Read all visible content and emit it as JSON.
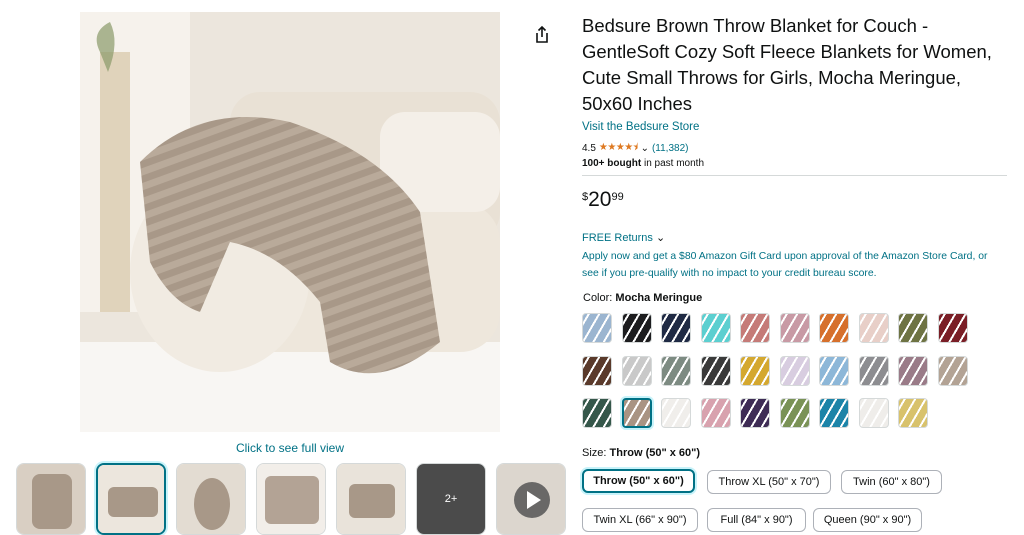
{
  "product": {
    "title": "Bedsure Brown Throw Blanket for Couch - GentleSoft Cozy Soft Fleece Blankets for Women, Cute Small Throws for Girls, Mocha Meringue, 50x60 Inches",
    "store_link": "Visit the Bedsure Store",
    "rating_value": "4.5",
    "rating_stars": "★★★★⯨",
    "rating_count": "(11,382)",
    "bought_bold": "100+ bought",
    "bought_rest": " in past month"
  },
  "price": {
    "symbol": "$",
    "whole": "20",
    "fraction": "99"
  },
  "returns_label": "FREE Returns",
  "promo_text": "Apply now and get a $80 Amazon Gift Card upon approval of the Amazon Store Card, or see if you pre-qualify with no impact to your credit bureau score.",
  "gallery": {
    "full_view_label": "Click to see full view",
    "more_label": "2+",
    "colors": {
      "blanket": "#a89888",
      "sofa": "#ece5da",
      "rug": "#f5f2ee",
      "wall": "#e9e3da"
    }
  },
  "color_selector": {
    "label": "Color: ",
    "selected": "Mocha Meringue",
    "swatches": [
      {
        "name": "light blue",
        "color": "#9bb5d0"
      },
      {
        "name": "black",
        "color": "#1d1d1f"
      },
      {
        "name": "navy",
        "color": "#1f2a44"
      },
      {
        "name": "teal",
        "color": "#5ccfd0"
      },
      {
        "name": "terracotta pink",
        "color": "#c57b78"
      },
      {
        "name": "dusty rose",
        "color": "#c89aa5"
      },
      {
        "name": "orange",
        "color": "#d6702c"
      },
      {
        "name": "blush",
        "color": "#e8cfc8"
      },
      {
        "name": "olive",
        "color": "#6e7343"
      },
      {
        "name": "burgundy",
        "color": "#7a1e26"
      },
      {
        "name": "chocolate",
        "color": "#5a3a2b"
      },
      {
        "name": "light grey",
        "color": "#c9c9c9"
      },
      {
        "name": "sage grey",
        "color": "#7d8b82"
      },
      {
        "name": "charcoal",
        "color": "#3a3a3a"
      },
      {
        "name": "mustard",
        "color": "#d4a830"
      },
      {
        "name": "lavender",
        "color": "#d8cde0"
      },
      {
        "name": "sky blue",
        "color": "#8db7d8"
      },
      {
        "name": "grey",
        "color": "#8d8d91"
      },
      {
        "name": "mauve",
        "color": "#9a7b88"
      },
      {
        "name": "taupe",
        "color": "#b3a395"
      },
      {
        "name": "forest green",
        "color": "#35574a"
      },
      {
        "name": "mocha meringue",
        "color": "#a99483"
      },
      {
        "name": "white",
        "color": "#f0eeeb"
      },
      {
        "name": "pink",
        "color": "#d8a2ae"
      },
      {
        "name": "purple",
        "color": "#3e2c55"
      },
      {
        "name": "green",
        "color": "#7a9256"
      },
      {
        "name": "ocean blue",
        "color": "#1c84a8"
      },
      {
        "name": "cream",
        "color": "#efedea"
      },
      {
        "name": "gold",
        "color": "#d8c26c"
      }
    ]
  },
  "size_selector": {
    "label": "Size: ",
    "selected": "Throw (50\" x 60\")",
    "options": [
      "Throw (50\" x 60\")",
      "Throw XL (50\" x 70\")",
      "Twin (60\" x 80\")",
      "Twin XL (66\" x 90\")",
      "Full (84\" x 90\")",
      "Queen (90\" x 90\")"
    ]
  },
  "accent": {
    "link": "#007185",
    "star": "#de7921",
    "selected_border": "#007185"
  }
}
